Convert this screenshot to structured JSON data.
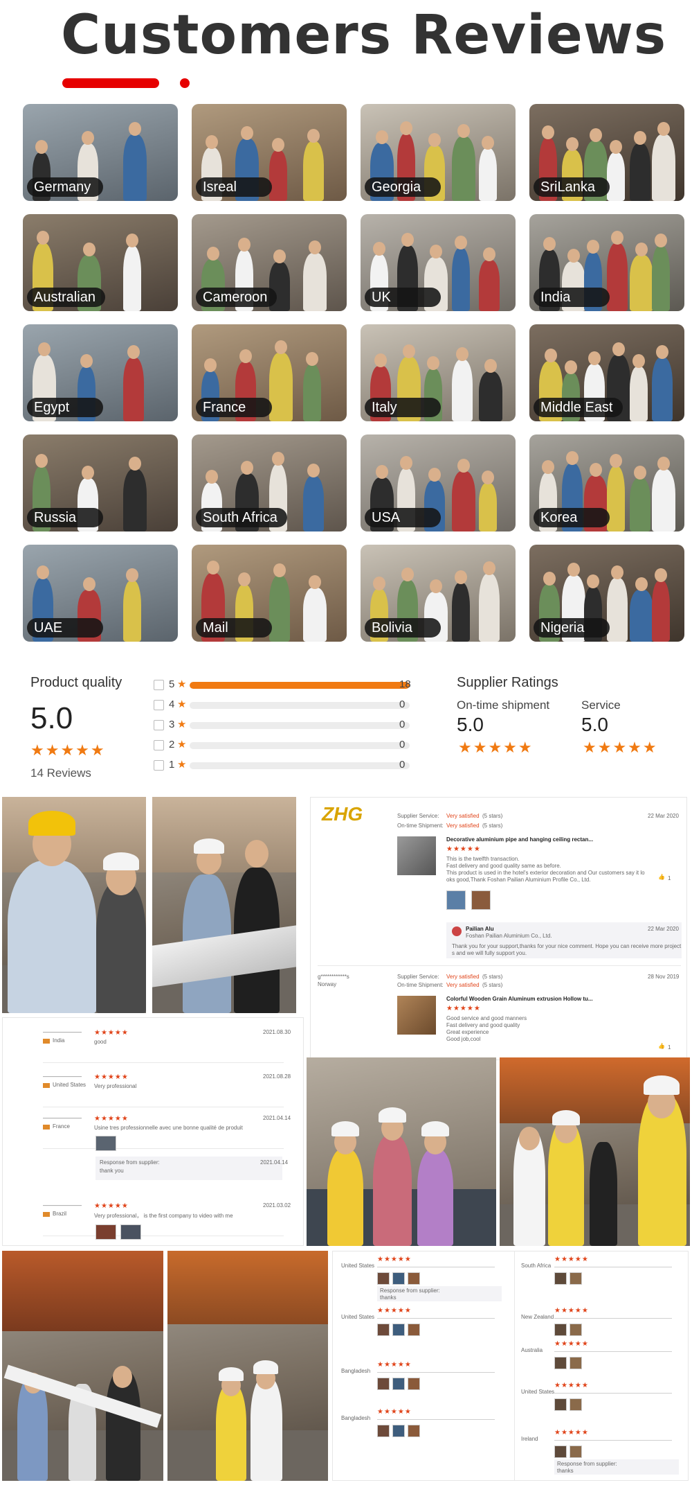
{
  "header": {
    "title": "Customers Reviews"
  },
  "countries": [
    "Germany",
    "Isreal",
    "Georgia",
    "SriLanka",
    "Australian",
    "Cameroon",
    "UK",
    "India",
    "Egypt",
    "France",
    "Italy",
    "Middle East",
    "Russia",
    "South Africa",
    "USA",
    "Korea",
    "UAE",
    "Mail",
    "Bolivia",
    "Nigeria"
  ],
  "product_quality": {
    "title": "Product quality",
    "score": "5.0",
    "stars": "★★★★★",
    "reviews": "14 Reviews",
    "distribution": [
      {
        "star": "5",
        "count": "18",
        "fraction": 1.0
      },
      {
        "star": "4",
        "count": "0",
        "fraction": 0
      },
      {
        "star": "3",
        "count": "0",
        "fraction": 0
      },
      {
        "star": "2",
        "count": "0",
        "fraction": 0
      },
      {
        "star": "1",
        "count": "0",
        "fraction": 0
      }
    ]
  },
  "supplier_ratings": {
    "title": "Supplier Ratings",
    "items": [
      {
        "label": "On-time shipment",
        "score": "5.0",
        "stars": "★★★★★"
      },
      {
        "label": "Service",
        "score": "5.0",
        "stars": "★★★★★"
      }
    ]
  },
  "review_shot": {
    "supplier_service_label": "Supplier Service:",
    "supplier_service_value": "Very satisfied",
    "supplier_service_stars": "(5 stars)",
    "ontime_label": "On-time Shipment:",
    "ontime_value": "Very satisfied",
    "ontime_stars": "(5 stars)",
    "date1": "22 Mar 2020",
    "product1": "Decorative aluminium pipe and hanging ceiling rectan...",
    "stars": "★★★★★",
    "text1a": "This is the twelfth transaction.",
    "text1b": "Fast delivery and good quality same as before.",
    "text1c": "This product is used in the hotel's exterior decoration and Our customers say it lo",
    "text1d": "oks good,Thank Foshan Pailian Aluminium Profile Co., Ltd.",
    "like1": "1",
    "reply_name": "Pailian Alu",
    "reply_company": "Foshan Pailian Aluminium Co., Ltd.",
    "reply_date": "22 Mar 2020",
    "reply_text_a": "Thank you for your support,thanks for your nice comment. Hope you can receive more project",
    "reply_text_b": "s and we will fully support you.",
    "reviewer2": "g************s",
    "country2": "Norway",
    "date2": "28 Nov 2019",
    "product2": "Colorful Wooden Grain Aluminum extrusion Hollow tu...",
    "text2a": "Good service and good manners",
    "text2b": "Fast delivery and good quality",
    "text2c": "Great experience",
    "text2d": "Good job,cool",
    "like2": "1"
  },
  "review_list_small": [
    {
      "country": "India",
      "text": "good",
      "date": "2021.08.30"
    },
    {
      "country": "United States",
      "text": "Very professional",
      "date": "2021.08.28"
    },
    {
      "country": "France",
      "text": "Usine tres professionnelle avec une bonne qualité de produit",
      "date": "2021.04.14"
    },
    {
      "country": "Brazil",
      "text": "Very professional， is the first company to video with me",
      "date": "2021.03.02"
    }
  ],
  "response_small": {
    "title": "Response from supplier:",
    "text": "thank you",
    "date": "2021.04.14"
  },
  "collage_bottom": {
    "left_countries": [
      "United States",
      "United States",
      "Bangladesh",
      "Bangladesh"
    ],
    "right_countries": [
      "South Africa",
      "New Zealand",
      "Australia",
      "United States",
      "Ireland"
    ],
    "response_title": "Response from supplier:",
    "response_text": "thanks"
  },
  "colors": {
    "accent": "#e60000",
    "star": "#f07a12"
  }
}
